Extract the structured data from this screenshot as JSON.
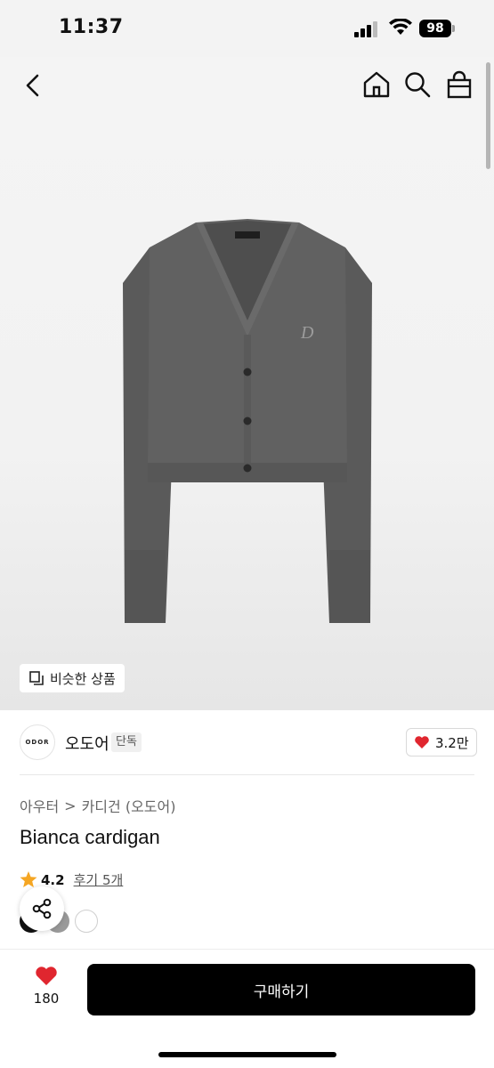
{
  "status": {
    "time": "11:37",
    "battery": "98"
  },
  "gallery": {
    "similar_label": "비슷한 상품",
    "logo_text": "D"
  },
  "brand": {
    "logo_text": "ODOR",
    "name": "오도어",
    "badge": "단독",
    "like_count": "3.2만"
  },
  "breadcrumb": {
    "category": "아우터",
    "separator": ">",
    "subcategory": "카디건 (오도어)"
  },
  "product": {
    "title": "Bianca cardigan",
    "rating": "4.2",
    "review_label": "후기 5개"
  },
  "swatches": [
    {
      "color": "#111111"
    },
    {
      "color": "#9a9a9a"
    },
    {
      "color": "#ffffff"
    }
  ],
  "bottom_bar": {
    "wish_count": "180",
    "buy_label": "구매하기"
  },
  "colors": {
    "accent_red": "#e0262f",
    "star": "#f5a623",
    "sweater": "#5c5c5c"
  }
}
